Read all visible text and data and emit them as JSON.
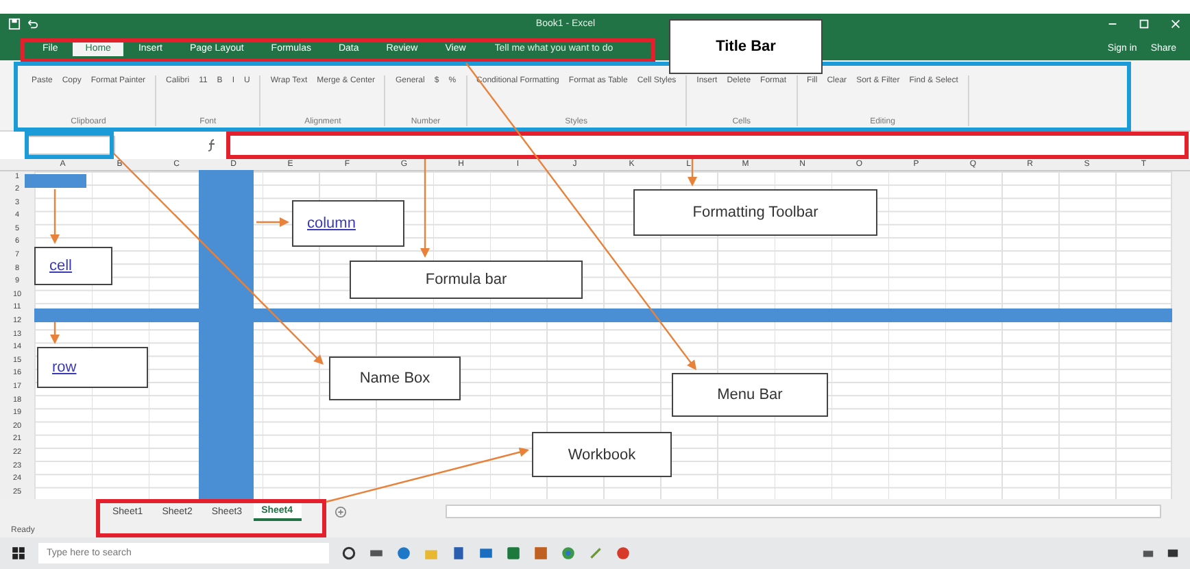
{
  "window": {
    "title": "Book1 - Excel"
  },
  "menu_tabs": [
    {
      "label": "File",
      "selected": false
    },
    {
      "label": "Home",
      "selected": true
    },
    {
      "label": "Insert",
      "selected": false
    },
    {
      "label": "Page Layout",
      "selected": false
    },
    {
      "label": "Formulas",
      "selected": false
    },
    {
      "label": "Data",
      "selected": false
    },
    {
      "label": "Review",
      "selected": false
    },
    {
      "label": "View",
      "selected": false
    }
  ],
  "tell_me": {
    "placeholder": "Tell me what you want to do"
  },
  "account": {
    "sign_in": "Sign in",
    "share": "Share"
  },
  "ribbon_groups": [
    {
      "label": "Clipboard",
      "commands": [
        "Paste",
        "Copy",
        "Format Painter"
      ]
    },
    {
      "label": "Font",
      "commands": [
        "Calibri",
        "11",
        "B",
        "I",
        "U"
      ]
    },
    {
      "label": "Alignment",
      "commands": [
        "Wrap Text",
        "Merge & Center"
      ]
    },
    {
      "label": "Number",
      "commands": [
        "General",
        "$",
        "%"
      ]
    },
    {
      "label": "Styles",
      "commands": [
        "Conditional Formatting",
        "Format as Table",
        "Cell Styles"
      ]
    },
    {
      "label": "Cells",
      "commands": [
        "Insert",
        "Delete",
        "Format"
      ]
    },
    {
      "label": "Editing",
      "commands": [
        "Fill",
        "Clear",
        "Sort & Filter",
        "Find & Select"
      ]
    }
  ],
  "columns": [
    "A",
    "B",
    "C",
    "D",
    "E",
    "F",
    "G",
    "H",
    "I",
    "J",
    "K",
    "L",
    "M",
    "N",
    "O",
    "P",
    "Q",
    "R",
    "S",
    "T"
  ],
  "rows": [
    "1",
    "2",
    "3",
    "4",
    "5",
    "6",
    "7",
    "8",
    "9",
    "10",
    "11",
    "12",
    "13",
    "14",
    "15",
    "16",
    "17",
    "18",
    "19",
    "20",
    "21",
    "22",
    "23",
    "24",
    "25"
  ],
  "sheet_tabs": [
    {
      "label": "Sheet1",
      "selected": false
    },
    {
      "label": "Sheet2",
      "selected": false
    },
    {
      "label": "Sheet3",
      "selected": false
    },
    {
      "label": "Sheet4",
      "selected": true
    }
  ],
  "status_bar": {
    "text": "Ready"
  },
  "taskbar": {
    "search_placeholder": "Type here to search"
  },
  "annotations": {
    "frames": [
      {
        "color": "#e3202b"
      },
      {
        "color": "#1b9bd8"
      },
      {
        "color": "#1b9bd8"
      },
      {
        "color": "#e3202b"
      },
      {
        "color": "#e3202b"
      }
    ],
    "labels": [
      {
        "text": "Title Bar",
        "kind": "heading"
      },
      {
        "text": "column",
        "kind": "link"
      },
      {
        "text": "cell",
        "kind": "link"
      },
      {
        "text": "Formula bar",
        "kind": "plain"
      },
      {
        "text": "Formatting Toolbar",
        "kind": "plain"
      },
      {
        "text": "row",
        "kind": "link"
      },
      {
        "text": "Name Box",
        "kind": "plain"
      },
      {
        "text": "Menu Bar",
        "kind": "plain"
      },
      {
        "text": "Workbook",
        "kind": "plain"
      }
    ]
  }
}
